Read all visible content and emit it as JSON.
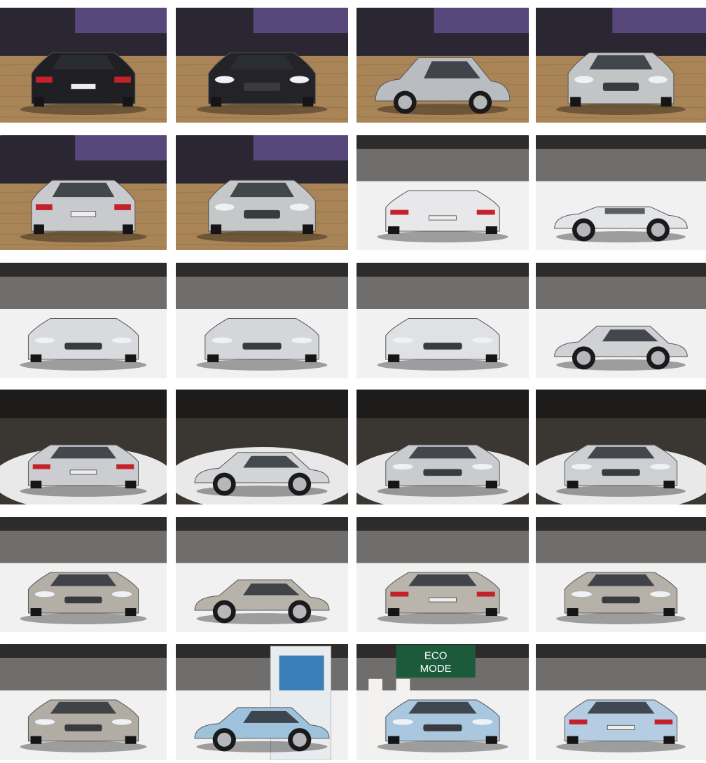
{
  "gallery": {
    "rows": 6,
    "cols": 4,
    "tiles": [
      {
        "car": "suv",
        "view": "rear",
        "color": "#1f1f24",
        "floor": "wood"
      },
      {
        "car": "suv",
        "view": "front",
        "color": "#232328",
        "floor": "wood"
      },
      {
        "car": "suv",
        "view": "side",
        "color": "#b9bcc1",
        "floor": "wood"
      },
      {
        "car": "suv",
        "view": "front",
        "color": "#c3c4c6",
        "floor": "wood"
      },
      {
        "car": "suv",
        "view": "rear",
        "color": "#c8cacd",
        "floor": "wood"
      },
      {
        "car": "suv",
        "view": "front",
        "color": "#c6c7c9",
        "floor": "wood"
      },
      {
        "car": "convertible",
        "view": "rear",
        "color": "#e8e8ea",
        "floor": "white"
      },
      {
        "car": "convertible",
        "view": "side",
        "color": "#e4e5e8",
        "floor": "white"
      },
      {
        "car": "convertible",
        "view": "front",
        "color": "#d8dadd",
        "floor": "white"
      },
      {
        "car": "convertible",
        "view": "front",
        "color": "#d4d6da",
        "floor": "white"
      },
      {
        "car": "convertible",
        "view": "front",
        "color": "#e0e1e4",
        "floor": "white"
      },
      {
        "car": "coupe",
        "view": "side",
        "color": "#cfd1d4",
        "floor": "white"
      },
      {
        "car": "coupe",
        "view": "rear",
        "color": "#cbcdd0",
        "floor": "dark"
      },
      {
        "car": "coupe",
        "view": "side",
        "color": "#d2d4d7",
        "floor": "dark"
      },
      {
        "car": "coupe",
        "view": "front",
        "color": "#c9cbce",
        "floor": "dark"
      },
      {
        "car": "coupe",
        "view": "front",
        "color": "#cdcfd2",
        "floor": "dark"
      },
      {
        "car": "sedan",
        "view": "front",
        "color": "#b3aea6",
        "floor": "white"
      },
      {
        "car": "sedan",
        "view": "side",
        "color": "#b7b2aa",
        "floor": "white"
      },
      {
        "car": "sedan",
        "view": "rear",
        "color": "#b9b4ac",
        "floor": "white"
      },
      {
        "car": "sedan",
        "view": "front",
        "color": "#b5b0a8",
        "floor": "white"
      },
      {
        "car": "sedan",
        "view": "front",
        "color": "#b1aca4",
        "floor": "white"
      },
      {
        "car": "hatchback",
        "view": "side",
        "color": "#9fc2dc",
        "floor": "white"
      },
      {
        "car": "hatchback",
        "view": "front",
        "color": "#a9c7df",
        "floor": "white"
      },
      {
        "car": "hatchback",
        "view": "rear",
        "color": "#b5cde2",
        "floor": "white"
      }
    ],
    "signs": {
      "eco_line1": "ECO",
      "eco_line2": "MODE"
    }
  }
}
